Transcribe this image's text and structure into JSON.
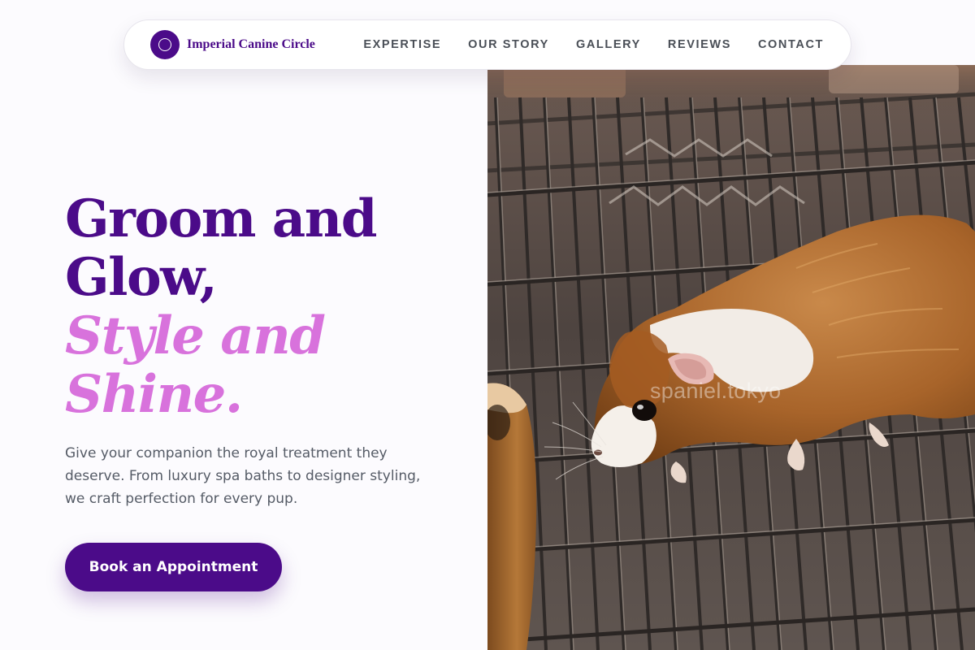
{
  "nav": {
    "brand_name": "Imperial Canine Circle",
    "links": [
      {
        "label": "EXPERTISE"
      },
      {
        "label": "OUR STORY"
      },
      {
        "label": "GALLERY"
      },
      {
        "label": "REVIEWS"
      },
      {
        "label": "CONTACT"
      }
    ]
  },
  "hero": {
    "title_line1": "Groom and",
    "title_line2": "Glow,",
    "title_accent_line1": "Style and",
    "title_accent_line2": "Shine.",
    "description": "Give your companion the royal treatment they deserve. From luxury spa baths to designer styling, we craft perfection for every pup.",
    "cta_label": "Book an Appointment",
    "image_watermark": "spaniel.tokyo"
  },
  "colors": {
    "brand_purple": "#4b0b89",
    "accent_pink": "#d872dc",
    "body_text": "#555b66",
    "nav_text": "#4a4f57"
  }
}
